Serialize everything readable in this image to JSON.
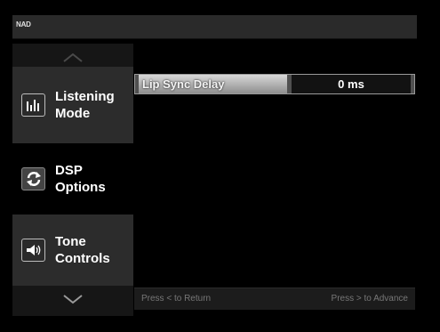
{
  "header": {
    "brand": "NAD"
  },
  "sidebar": {
    "items": [
      {
        "label": "Listening Mode",
        "icon": "equalizer-icon",
        "state": "inactive"
      },
      {
        "label": "DSP Options",
        "icon": "refresh-cycle-icon",
        "state": "active"
      },
      {
        "label": "Tone Controls",
        "icon": "speaker-volume-icon",
        "state": "inactive"
      }
    ]
  },
  "setting": {
    "label": "Lip Sync Delay",
    "value": "0 ms"
  },
  "footer": {
    "back_hint": "Press < to Return",
    "advance_hint": "Press > to Advance"
  }
}
